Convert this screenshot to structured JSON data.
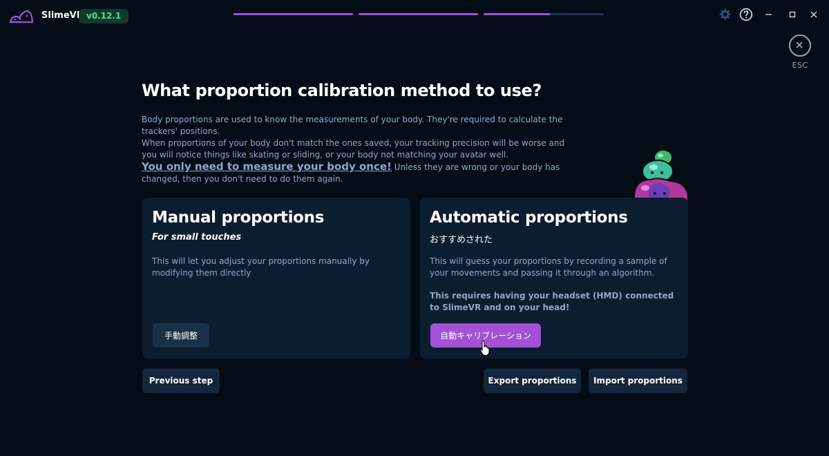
{
  "app": {
    "name": "SlimeVR",
    "version": "v0.12.1"
  },
  "wizard_progress": [
    1.0,
    1.0,
    0.55
  ],
  "esc": {
    "label": "ESC"
  },
  "page": {
    "heading": "What proportion calibration method to use?",
    "desc_line1": "Body proportions are used to know the measurements of your body. They're required to calculate the trackers' positions.",
    "desc_line2": "When proportions of your body don't match the ones saved, your tracking precision will be worse and you will notice things like skating or sliding, or your body not matching your avatar well.",
    "desc_emphasis": "You only need to measure your body once!",
    "desc_tail": " Unless they are wrong or your body has changed, then you don't need to do them again."
  },
  "manual_card": {
    "title": "Manual proportions",
    "subtitle": "For small touches",
    "body": "This will let you adjust your proportions manually by modifying them directly",
    "button": "手動調整"
  },
  "auto_card": {
    "title": "Automatic proportions",
    "subtitle": "おすすめされた",
    "body": "This will guess your proportions by recording a sample of your movements and passing it through an algorithm.",
    "warning": "This requires having your headset (HMD) connected to SlimeVR and on your head!",
    "button": "自動キャリブレーション"
  },
  "footer": {
    "previous": "Previous step",
    "export": "Export proportions",
    "import": "Import proportions"
  },
  "colors": {
    "accent": "#a352d6",
    "background": "#040d17",
    "card": "#0d1d30",
    "version_text": "#4ee28f"
  },
  "icons": [
    "slimevr-logo-icon",
    "settings-gear-icon",
    "help-icon",
    "minimize-icon",
    "maximize-icon",
    "close-window-icon",
    "close-circle-icon",
    "slime-mascot-icon",
    "mouse-cursor-icon"
  ]
}
